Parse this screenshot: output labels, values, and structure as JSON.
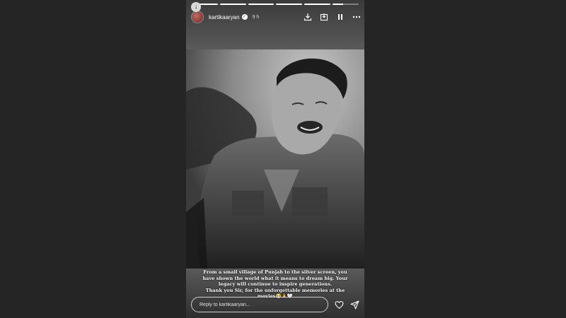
{
  "story": {
    "progress": [
      {
        "fill_percent": 100
      },
      {
        "fill_percent": 100
      },
      {
        "fill_percent": 100
      },
      {
        "fill_percent": 100
      },
      {
        "fill_percent": 100
      },
      {
        "fill_percent": 40
      }
    ],
    "header": {
      "username": "kartikaaryan",
      "time": "9 h"
    },
    "caption": {
      "line1": "From a small village of Punjab to the silver screen, you",
      "line2": "have shown the world what it means to dream big. Your",
      "line3": "legacy will continue to inspire generations.",
      "line4": "Thank you Sir, for the unforgettable memories at the",
      "line5": "movies🥺🙏🤍"
    },
    "reply": {
      "placeholder": "Reply to kartikaaryan..."
    },
    "colors": {
      "background": "#252525",
      "story_bg": "#4a4a4a",
      "text": "#ffffff"
    },
    "icons": [
      "download-icon",
      "save-icon",
      "pause-icon",
      "more-icon",
      "heart-icon",
      "send-icon",
      "verified-icon"
    ]
  }
}
